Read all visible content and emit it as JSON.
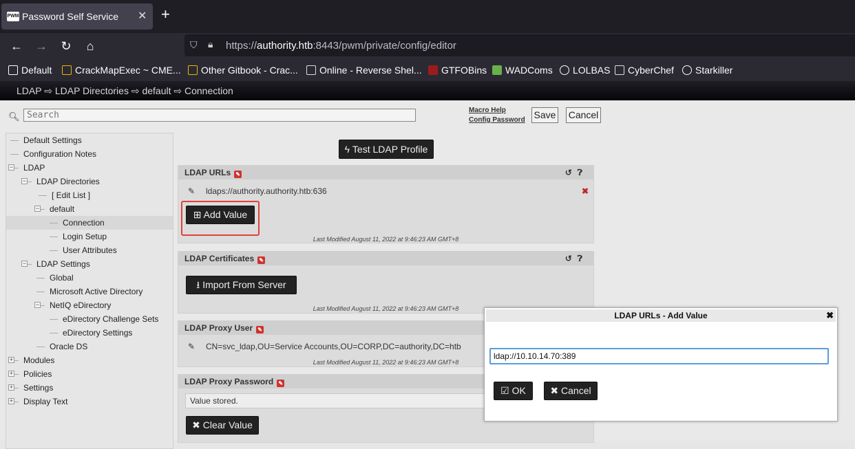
{
  "browser": {
    "tab_title": "Password Self Service",
    "favicon_text": "PWM",
    "url_prefix": "https://",
    "url_host": "authority.htb",
    "url_rest": ":8443/pwm/private/config/editor",
    "bookmarks": [
      {
        "label": "Default",
        "icon": "folder-icon",
        "color": "#fbfbfe"
      },
      {
        "label": "CrackMapExec ~ CME...",
        "icon": "cme-icon",
        "color": "#e8b800"
      },
      {
        "label": "Other Gitbook - Crac...",
        "icon": "gitbook-icon",
        "color": "#e8b800"
      },
      {
        "label": "Online - Reverse Shel...",
        "icon": "skull-icon",
        "color": "#dddddd"
      },
      {
        "label": "GTFOBins",
        "icon": "gtfobins-icon",
        "color": "#9b1c1c"
      },
      {
        "label": "WADComs",
        "icon": "windows-icon",
        "color": "#6ab04c"
      },
      {
        "label": "LOLBAS",
        "icon": "globe-icon",
        "color": "#fbfbfe"
      },
      {
        "label": "CyberChef",
        "icon": "chef-icon",
        "color": "#dddddd"
      },
      {
        "label": "Starkiller",
        "icon": "globe-icon",
        "color": "#fbfbfe"
      }
    ]
  },
  "app": {
    "breadcrumb": "LDAP ⇨ LDAP Directories ⇨ default ⇨ Connection",
    "search_placeholder": "Search",
    "macro_help": "Macro Help",
    "config_password": "Config Password",
    "save_label": "Save",
    "cancel_label": "Cancel"
  },
  "tree": {
    "items": [
      {
        "label": "Default Settings",
        "toggle": ""
      },
      {
        "label": "Configuration Notes",
        "toggle": ""
      },
      {
        "label": "LDAP",
        "toggle": "−"
      },
      {
        "label": "LDAP Directories",
        "toggle": "−"
      },
      {
        "label": "[  Edit List  ]",
        "toggle": ""
      },
      {
        "label": "default",
        "toggle": "−"
      },
      {
        "label": "Connection",
        "toggle": ""
      },
      {
        "label": "Login Setup",
        "toggle": ""
      },
      {
        "label": "User Attributes",
        "toggle": ""
      },
      {
        "label": "LDAP Settings",
        "toggle": "−"
      },
      {
        "label": "Global",
        "toggle": ""
      },
      {
        "label": "Microsoft Active Directory",
        "toggle": ""
      },
      {
        "label": "NetIQ eDirectory",
        "toggle": "−"
      },
      {
        "label": "eDirectory Challenge Sets",
        "toggle": ""
      },
      {
        "label": "eDirectory Settings",
        "toggle": ""
      },
      {
        "label": "Oracle DS",
        "toggle": ""
      },
      {
        "label": "Modules",
        "toggle": "+"
      },
      {
        "label": "Policies",
        "toggle": "+"
      },
      {
        "label": "Settings",
        "toggle": "+"
      },
      {
        "label": "Display Text",
        "toggle": "+"
      }
    ]
  },
  "main": {
    "test_ldap_label": "Test LDAP Profile",
    "ldap_urls": {
      "title": "LDAP URLs",
      "value": "ldaps://authority.authority.htb:636",
      "add_value_label": "Add Value",
      "modified": "Last Modified August 11, 2022 at 9:46:23 AM GMT+8"
    },
    "ldap_certificates": {
      "title": "LDAP Certificates",
      "import_label": "Import From Server",
      "modified": "Last Modified August 11, 2022 at 9:46:23 AM GMT+8"
    },
    "ldap_proxy_user": {
      "title": "LDAP Proxy User",
      "value": "CN=svc_ldap,OU=Service Accounts,OU=CORP,DC=authority,DC=htb",
      "modified": "Last Modified August 11, 2022 at 9:46:23 AM GMT+8"
    },
    "ldap_proxy_password": {
      "title": "LDAP Proxy Password",
      "value": "Value stored.",
      "clear_label": "Clear Value"
    }
  },
  "dialog": {
    "title": "LDAP URLs - Add Value",
    "input_value": "ldap://10.10.14.70:389",
    "ok_label": "OK",
    "cancel_label": "Cancel"
  }
}
